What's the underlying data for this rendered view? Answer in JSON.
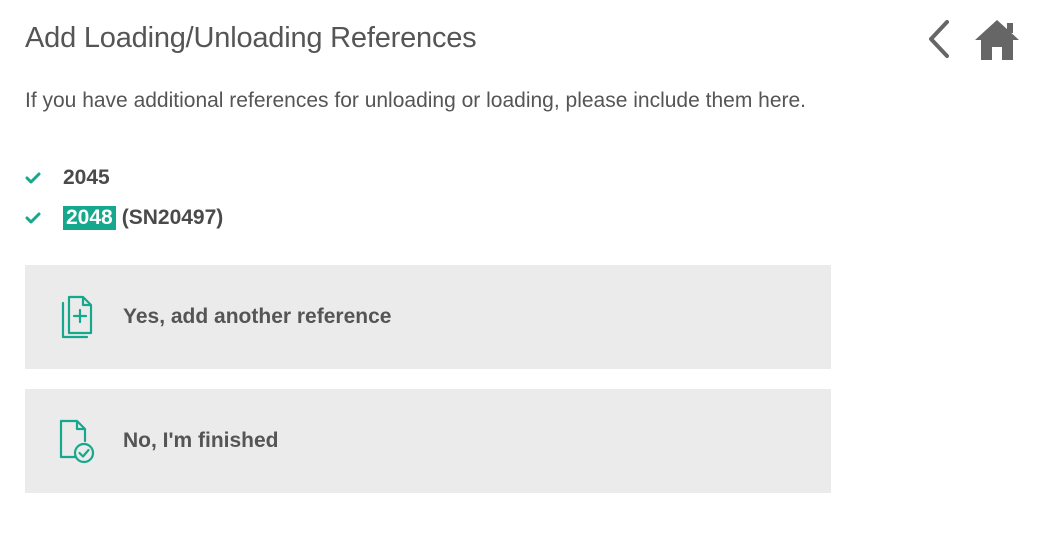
{
  "header": {
    "title": "Add Loading/Unloading References",
    "back_icon": "chevron-left-icon",
    "home_icon": "home-icon"
  },
  "intro": {
    "text": "If you have additional references for unloading or loading, please include them here."
  },
  "references": [
    {
      "number": "2045",
      "extra": "",
      "highlighted": false
    },
    {
      "number": "2048",
      "extra": "(SN20497)",
      "highlighted": true
    }
  ],
  "options": {
    "yes_label": "Yes, add another reference",
    "no_label": "No, I'm finished"
  },
  "colors": {
    "accent": "#15a88c",
    "button_bg": "#ebebeb",
    "icon_grey": "#666666"
  }
}
